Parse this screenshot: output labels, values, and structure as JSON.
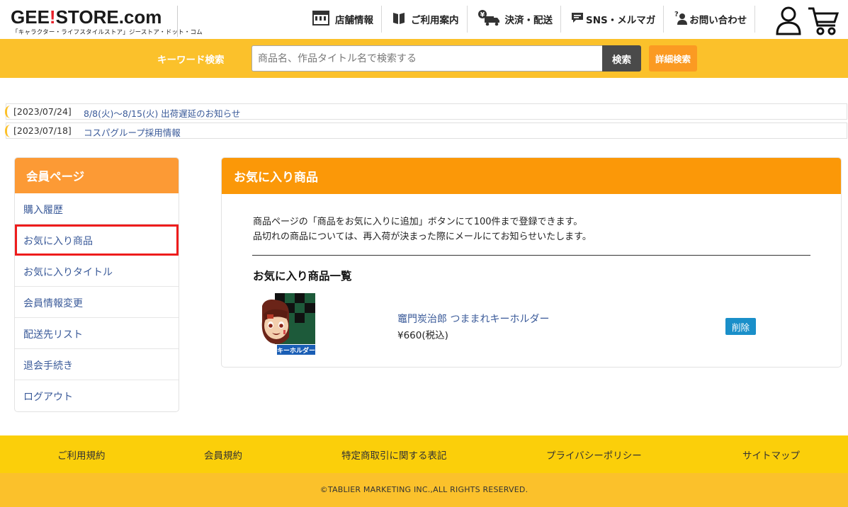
{
  "header": {
    "logo": {
      "gee": "GEE",
      "bang": "!",
      "store": "STORE.com",
      "tagline": "「キャラクター・ライフスタイルストア」ジーストア・ドット・コム"
    },
    "nav": [
      {
        "label": "店舗情報",
        "icon": "store-icon"
      },
      {
        "label": "ご利用案内",
        "icon": "book-icon"
      },
      {
        "label": "決済・配送",
        "icon": "yen-truck-icon"
      },
      {
        "label": "SNS・メルマガ",
        "icon": "message-icon"
      },
      {
        "label": "お問い合わせ",
        "icon": "inquiry-person-icon"
      }
    ]
  },
  "search": {
    "label": "キーワード検索",
    "placeholder": "商品名、作品タイトル名で検索する",
    "value": "",
    "button": "検索",
    "advanced": "詳細検索"
  },
  "news": [
    {
      "date": "[2023/07/24]",
      "title": "8/8(火)～8/15(火) 出荷遅延のお知らせ"
    },
    {
      "date": "[2023/07/18]",
      "title": "コスパグループ採用情報"
    }
  ],
  "sidebar": {
    "title": "会員ページ",
    "items": [
      {
        "label": "購入履歴"
      },
      {
        "label": "お気に入り商品"
      },
      {
        "label": "お気に入りタイトル"
      },
      {
        "label": "会員情報変更"
      },
      {
        "label": "配送先リスト"
      },
      {
        "label": "退会手続き"
      },
      {
        "label": "ログアウト"
      }
    ]
  },
  "main": {
    "title": "お気に入り商品",
    "desc_line1": "商品ページの「商品をお気に入りに追加」ボタンにて100件まで登録できます。",
    "desc_line2": "品切れの商品については、再入荷が決まった際にメールにてお知らせいたします。",
    "list_title": "お気に入り商品一覧",
    "product": {
      "name": "竈門炭治郎 つままれキーホルダー",
      "price": "¥660(税込)",
      "image_label": "キーホルダー",
      "delete": "削除"
    }
  },
  "footer": {
    "links": [
      "ご利用規約",
      "会員規約",
      "特定商取引に関する表記",
      "プライバシーポリシー",
      "サイトマップ"
    ],
    "copyright": "©TABLIER MARKETING INC.,ALL RIGHTS RESERVED."
  },
  "colors": {
    "search_bar": "#fbc12b",
    "sidebar_header": "#fc9a35",
    "panel_header": "#fb9808",
    "footer_links": "#fbcf0a",
    "link": "#3a5a99",
    "delete_button": "#1a8fc9",
    "active_outline": "#ee1c1c"
  }
}
